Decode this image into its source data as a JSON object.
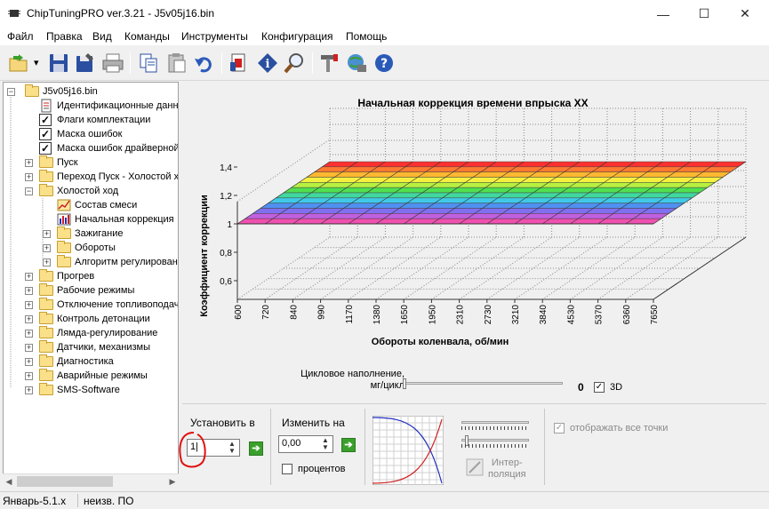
{
  "window": {
    "title": "ChipTuningPRO ver.3.21 - J5v05j16.bin",
    "minimize_glyph": "—",
    "maximize_glyph": "☐",
    "close_glyph": "✕"
  },
  "menu": [
    "Файл",
    "Правка",
    "Вид",
    "Команды",
    "Инструменты",
    "Конфигурация",
    "Помощь"
  ],
  "toolbar": {
    "icons": [
      "open-folder-icon",
      "save-icon",
      "save-as-icon",
      "print-icon",
      "copy-icon",
      "paste-icon",
      "undo-icon",
      "compare-icon",
      "info-icon",
      "search-icon",
      "tools-icon",
      "network-icon",
      "help-icon"
    ],
    "dropdown_glyph": "▾",
    "help_glyph": "?",
    "info_glyph": "i"
  },
  "tree": {
    "collapse_glyph": "−",
    "expand_glyph": "+",
    "check_glyph": "✓",
    "root": "J5v05j16.bin",
    "items": [
      {
        "label": "Идентификационные данн",
        "icon": "document-icon",
        "level": 1
      },
      {
        "label": "Флаги комплектации",
        "icon": "checkbox-icon",
        "level": 1
      },
      {
        "label": "Маска ошибок",
        "icon": "checkbox-icon",
        "level": 1
      },
      {
        "label": "Маска ошибок драйверной",
        "icon": "checkbox-icon",
        "level": 1
      },
      {
        "label": "Пуск",
        "icon": "folder-icon",
        "level": 1,
        "expander": "+"
      },
      {
        "label": "Переход Пуск - Холостой х",
        "icon": "folder-icon",
        "level": 1,
        "expander": "+"
      },
      {
        "label": "Холостой ход",
        "icon": "folder-icon",
        "level": 1,
        "expander": "−"
      },
      {
        "label": "Состав смеси",
        "icon": "curve-chart-icon",
        "level": 2
      },
      {
        "label": "Начальная коррекция",
        "icon": "bar-chart-icon",
        "level": 2
      },
      {
        "label": "Зажигание",
        "icon": "folder-icon",
        "level": 2,
        "expander": "+"
      },
      {
        "label": "Обороты",
        "icon": "folder-icon",
        "level": 2,
        "expander": "+"
      },
      {
        "label": "Алгоритм регулирован",
        "icon": "folder-icon",
        "level": 2,
        "expander": "+"
      },
      {
        "label": "Прогрев",
        "icon": "folder-icon",
        "level": 1,
        "expander": "+"
      },
      {
        "label": "Рабочие режимы",
        "icon": "folder-icon",
        "level": 1,
        "expander": "+"
      },
      {
        "label": "Отключение топливоподач",
        "icon": "folder-icon",
        "level": 1,
        "expander": "+"
      },
      {
        "label": "Контроль детонации",
        "icon": "folder-icon",
        "level": 1,
        "expander": "+"
      },
      {
        "label": "Лямда-регулирование",
        "icon": "folder-icon",
        "level": 1,
        "expander": "+"
      },
      {
        "label": "Датчики, механизмы",
        "icon": "folder-icon",
        "level": 1,
        "expander": "+"
      },
      {
        "label": "Диагностика",
        "icon": "folder-icon",
        "level": 1,
        "expander": "+"
      },
      {
        "label": "Аварийные режимы",
        "icon": "folder-icon",
        "level": 1,
        "expander": "+"
      },
      {
        "label": "SMS-Software",
        "icon": "folder-icon",
        "level": 1,
        "expander": "+"
      }
    ]
  },
  "chart_data": {
    "type": "surface-3d",
    "title": "Начальная коррекция времени впрыска XX",
    "xlabel": "Обороты коленвала, об/мин",
    "ylabel": "Коэффициент коррекции",
    "x": [
      "600",
      "720",
      "840",
      "990",
      "1170",
      "1380",
      "1650",
      "1950",
      "2310",
      "2730",
      "3210",
      "3840",
      "4530",
      "5370",
      "6360",
      "7650"
    ],
    "yticks": [
      "0,6",
      "0,8",
      "1",
      "1,2",
      "1,4"
    ],
    "ylim": [
      0.5,
      1.5
    ],
    "values": [
      1,
      1,
      1,
      1,
      1,
      1,
      1,
      1,
      1,
      1,
      1,
      1,
      1,
      1,
      1,
      1
    ],
    "grid": true,
    "band_colors": [
      "#ff3030",
      "#ff7a30",
      "#ffb830",
      "#f5f040",
      "#b8f040",
      "#50e050",
      "#40d8a0",
      "#40c8e8",
      "#5090f0",
      "#8070f0",
      "#c060e0",
      "#f050b0"
    ]
  },
  "bottom": {
    "cycle_fill_label_1": "Цикловое наполнение,",
    "cycle_fill_label_2": "мг/цикл",
    "cycle_fill_value": "0",
    "cycle_fill_level": 0,
    "check_3d": "3D",
    "check_3d_checked": true,
    "set_to_label": "Установить в",
    "set_to_value": "1|",
    "change_by_label": "Изменить на",
    "change_by_value": "0,00",
    "percent_label": "процентов",
    "percent_checked": false,
    "interp_label_1": "Интер-",
    "interp_label_2": "поляция",
    "show_all_points": "отображать все точки",
    "show_all_checked": true,
    "spin_up_glyph": "▲",
    "spin_down_glyph": "▼",
    "go_glyph": "➔"
  },
  "status": {
    "left": "Январь-5.1.x",
    "right": "неизв. ПО"
  },
  "colors": {
    "annotation_circle": "#e01010",
    "accent_green": "#3aa02c"
  }
}
